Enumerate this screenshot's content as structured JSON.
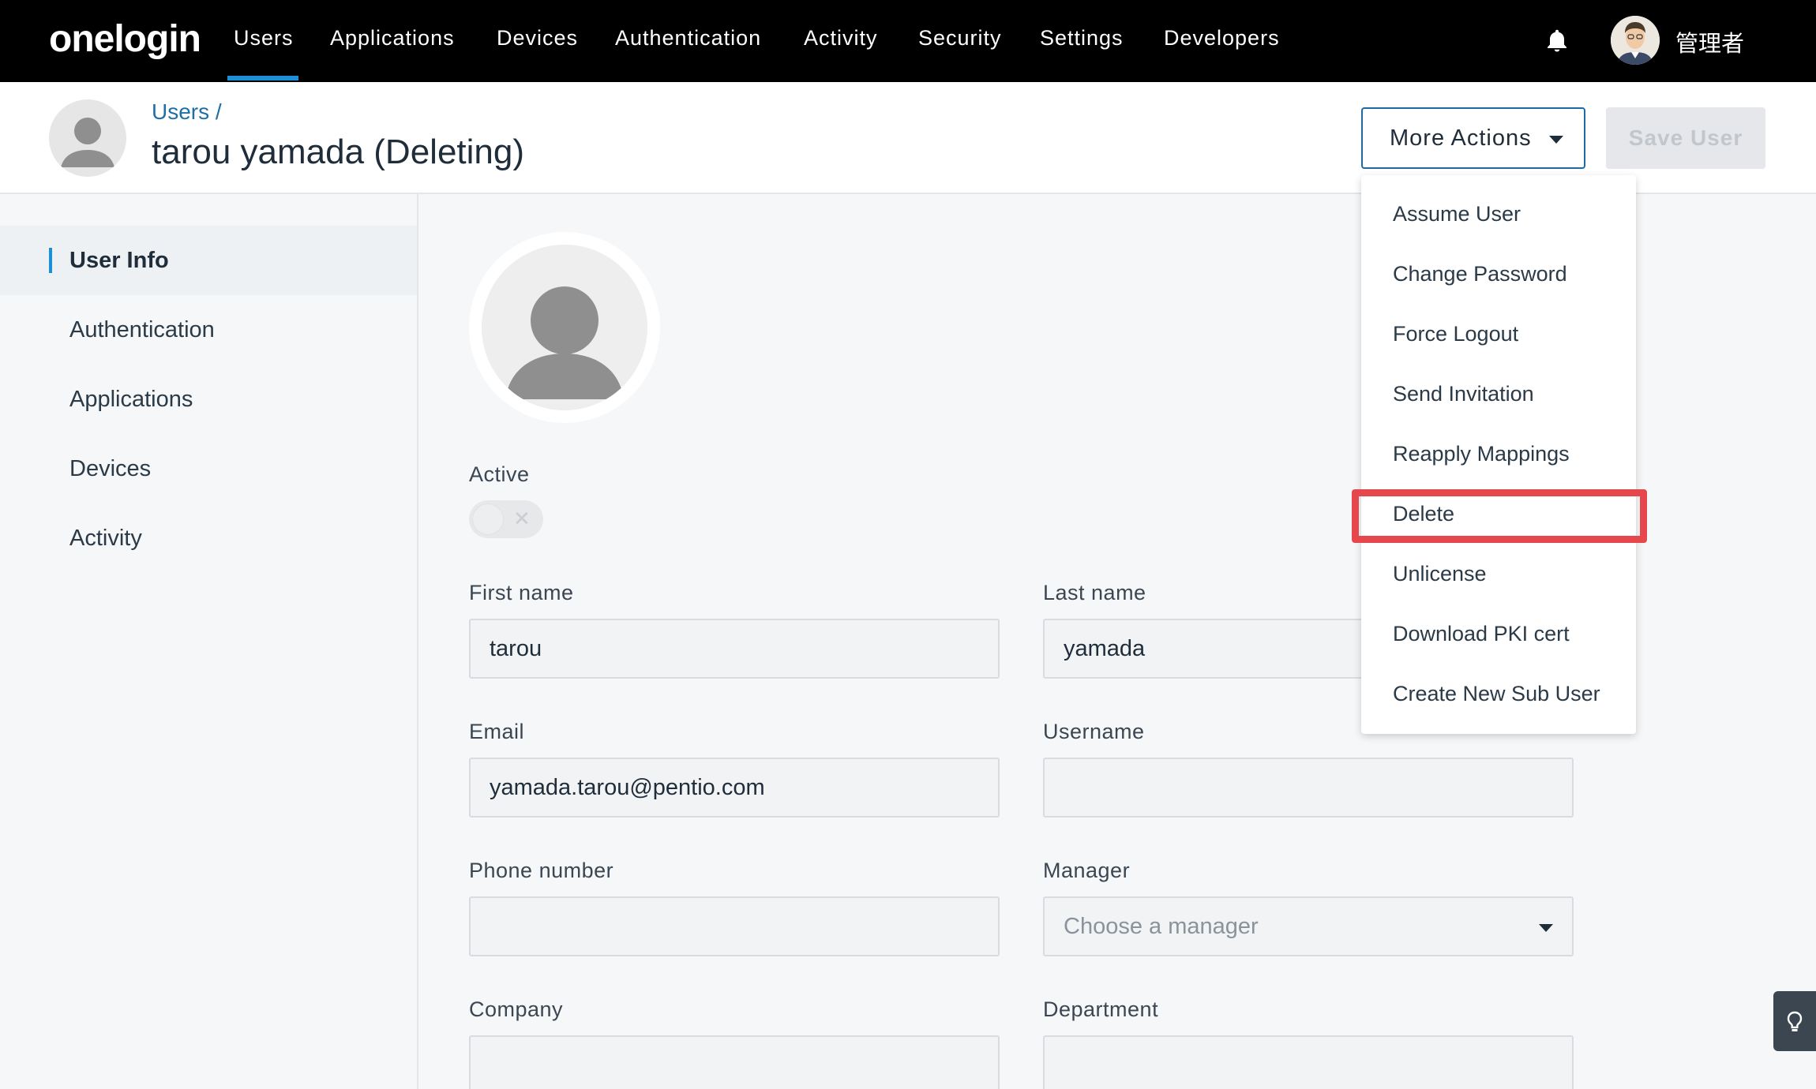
{
  "topnav": {
    "logo": "onelogin",
    "items": [
      "Users",
      "Applications",
      "Devices",
      "Authentication",
      "Activity",
      "Security",
      "Settings",
      "Developers"
    ],
    "active_item": "Users",
    "admin_name": "管理者",
    "icons": {
      "notifications": "bell-icon",
      "profile": "avatar"
    }
  },
  "header": {
    "breadcrumb": "Users /",
    "title": "tarou yamada (Deleting)",
    "more_actions_label": "More Actions",
    "save_label": "Save User"
  },
  "sidebar": {
    "items": [
      {
        "label": "User Info",
        "active": true
      },
      {
        "label": "Authentication",
        "active": false
      },
      {
        "label": "Applications",
        "active": false
      },
      {
        "label": "Devices",
        "active": false
      },
      {
        "label": "Activity",
        "active": false
      }
    ]
  },
  "form": {
    "active_label": "Active",
    "active_value": false,
    "first_name_label": "First name",
    "first_name": "tarou",
    "last_name_label": "Last name",
    "last_name": "yamada",
    "email_label": "Email",
    "email": "yamada.tarou@pentio.com",
    "username_label": "Username",
    "username": "",
    "phone_label": "Phone number",
    "phone": "",
    "manager_label": "Manager",
    "manager_placeholder": "Choose a manager",
    "company_label": "Company",
    "company": "",
    "department_label": "Department",
    "department": ""
  },
  "menu": {
    "items": [
      "Assume User",
      "Change Password",
      "Force Logout",
      "Send Invitation",
      "Reapply Mappings",
      "Delete",
      "Unlicense",
      "Download PKI cert",
      "Create New Sub User"
    ],
    "highlighted": "Delete"
  },
  "colors": {
    "accent": "#1c8fd6",
    "highlight": "#e5474d",
    "nav_bg": "#000000"
  }
}
